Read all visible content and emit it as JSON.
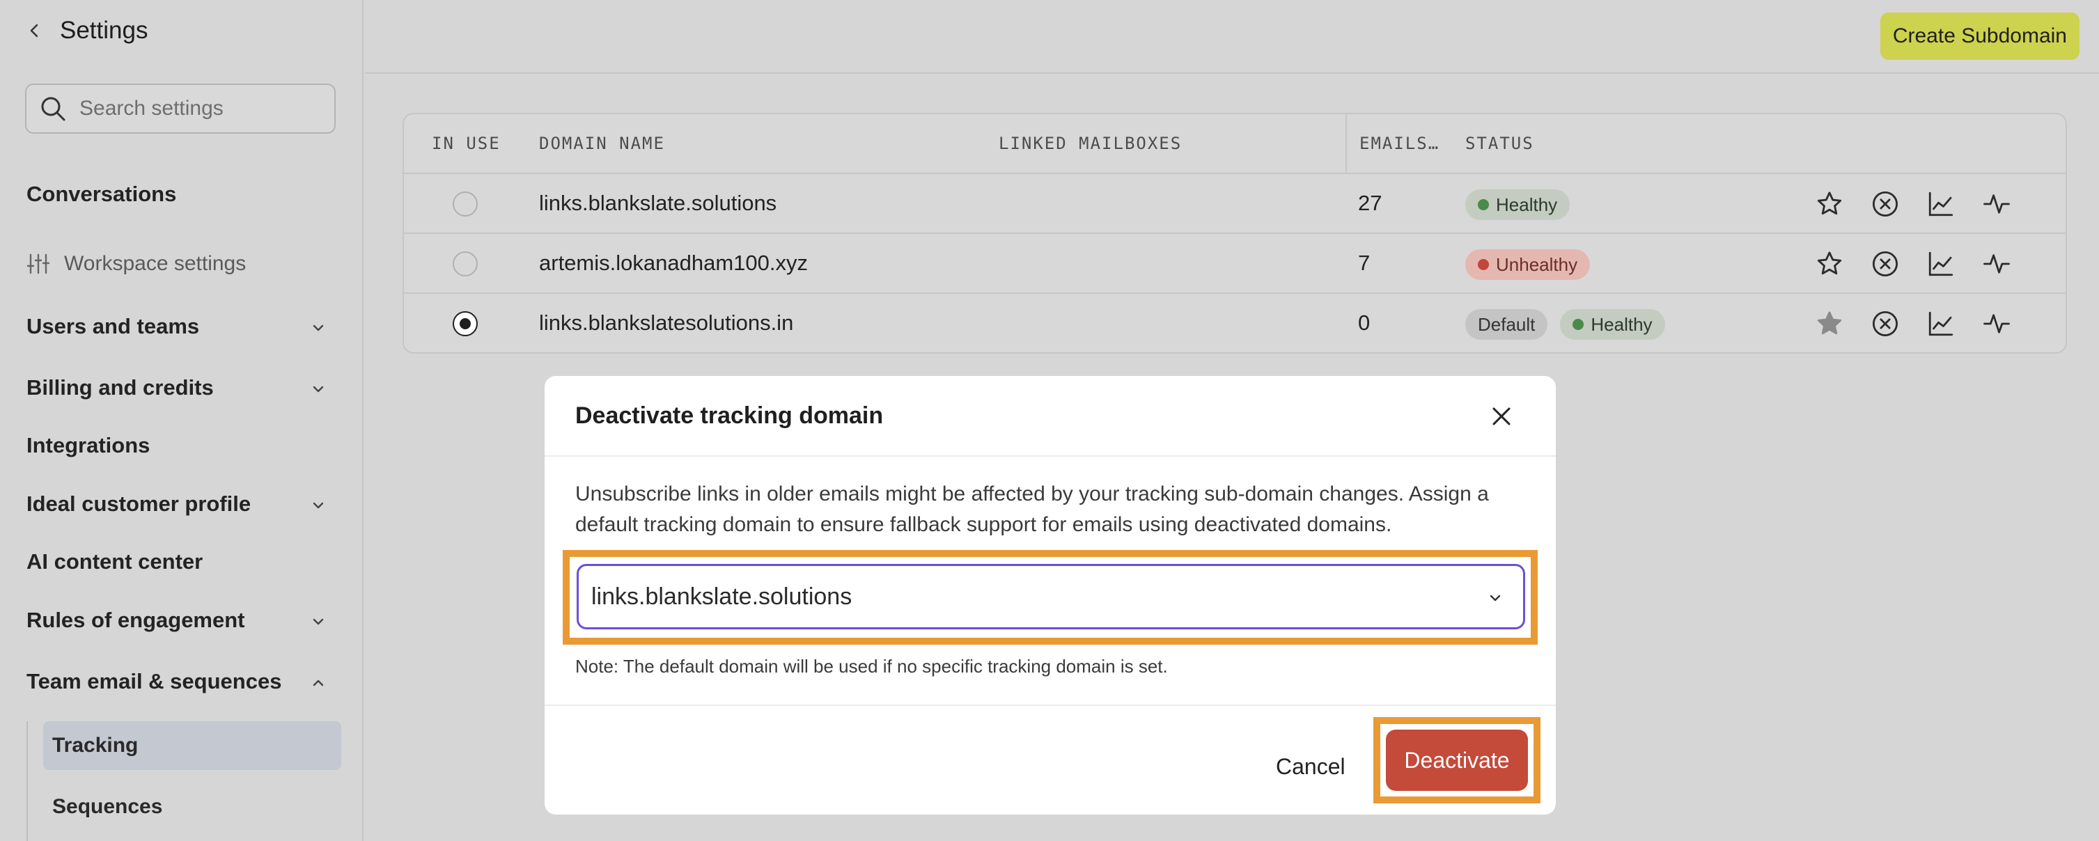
{
  "sidebar": {
    "back_icon": "chevron-left-icon",
    "title": "Settings",
    "search_placeholder": "Search settings",
    "items": [
      {
        "label": "Conversations",
        "expandable": false
      },
      {
        "label": "Workspace settings",
        "icon": "sliders-icon"
      },
      {
        "label": "Users and teams",
        "expandable": true
      },
      {
        "label": "Billing and credits",
        "expandable": true
      },
      {
        "label": "Integrations",
        "expandable": false
      },
      {
        "label": "Ideal customer profile",
        "expandable": true
      },
      {
        "label": "AI content center",
        "expandable": false
      },
      {
        "label": "Rules of engagement",
        "expandable": true
      },
      {
        "label": "Team email & sequences",
        "expandable": true,
        "expanded": true
      }
    ],
    "subitems": [
      {
        "label": "Tracking",
        "active": true
      },
      {
        "label": "Sequences",
        "active": false
      }
    ]
  },
  "topbar": {
    "create_label": "Create Subdomain"
  },
  "table": {
    "columns": [
      "IN USE",
      "DOMAIN NAME",
      "LINKED MAILBOXES",
      "EMAILS…",
      "STATUS"
    ],
    "rows": [
      {
        "in_use": false,
        "domain": "links.blankslate.solutions",
        "linked_mailboxes": "",
        "emails": "27",
        "badges": [
          {
            "label": "Healthy",
            "kind": "healthy"
          }
        ],
        "starred": false
      },
      {
        "in_use": false,
        "domain": "artemis.lokanadham100.xyz",
        "linked_mailboxes": "",
        "emails": "7",
        "badges": [
          {
            "label": "Unhealthy",
            "kind": "unhealthy"
          }
        ],
        "starred": false
      },
      {
        "in_use": true,
        "domain": "links.blankslatesolutions.in",
        "linked_mailboxes": "",
        "emails": "0",
        "badges": [
          {
            "label": "Default",
            "kind": "default"
          },
          {
            "label": "Healthy",
            "kind": "healthy"
          }
        ],
        "starred": true
      }
    ],
    "row_action_icons": [
      "star-icon",
      "x-circle-icon",
      "line-chart-icon",
      "activity-icon"
    ]
  },
  "modal": {
    "title": "Deactivate tracking domain",
    "description": "Unsubscribe links in older emails might be affected by your tracking sub-domain changes. Assign a default tracking domain to ensure fallback support for emails using deactivated domains.",
    "select_value": "links.blankslate.solutions",
    "note": "Note: The default domain will be used if no specific tracking domain is set.",
    "cancel_label": "Cancel",
    "confirm_label": "Deactivate"
  },
  "colors": {
    "accent_yellow": "#cdd24f",
    "danger": "#c44a3a",
    "highlight": "#e99a34",
    "focus": "#6c4fd8"
  }
}
